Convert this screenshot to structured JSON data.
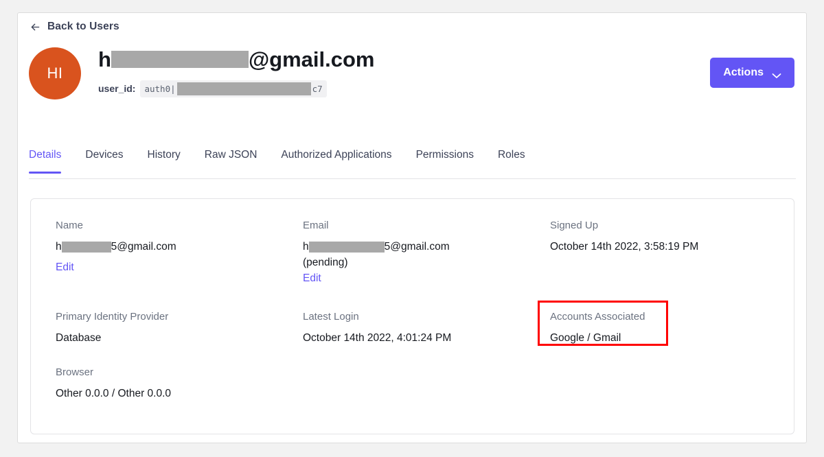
{
  "nav": {
    "back_label": "Back to Users",
    "back_icon": "arrow-left-icon"
  },
  "user": {
    "avatar_initials": "HI",
    "avatar_color": "#d9531e",
    "email_prefix": "h",
    "email_suffix": "@gmail.com",
    "userid_label": "user_id:",
    "userid_prefix": "auth0|",
    "userid_suffix": "c7"
  },
  "toolbar": {
    "actions_label": "Actions",
    "actions_icon": "chevron-down-icon",
    "accent_color": "#6355f5"
  },
  "tabs": [
    {
      "label": "Details",
      "active": true
    },
    {
      "label": "Devices",
      "active": false
    },
    {
      "label": "History",
      "active": false
    },
    {
      "label": "Raw JSON",
      "active": false
    },
    {
      "label": "Authorized Applications",
      "active": false
    },
    {
      "label": "Permissions",
      "active": false
    },
    {
      "label": "Roles",
      "active": false
    }
  ],
  "details": {
    "name": {
      "label": "Name",
      "value_prefix": "h",
      "value_suffix": "5@gmail.com",
      "edit_label": "Edit"
    },
    "email": {
      "label": "Email",
      "value_prefix": "h",
      "value_suffix": "5@gmail.com",
      "status": "(pending)",
      "edit_label": "Edit"
    },
    "signed_up": {
      "label": "Signed Up",
      "value": "October 14th 2022, 3:58:19 PM"
    },
    "primary_identity_provider": {
      "label": "Primary Identity Provider",
      "value": "Database"
    },
    "latest_login": {
      "label": "Latest Login",
      "value": "October 14th 2022, 4:01:24 PM"
    },
    "accounts_associated": {
      "label": "Accounts Associated",
      "value": "Google / Gmail",
      "highlight_color": "#ff0000"
    },
    "browser": {
      "label": "Browser",
      "value": "Other 0.0.0 / Other 0.0.0"
    }
  }
}
